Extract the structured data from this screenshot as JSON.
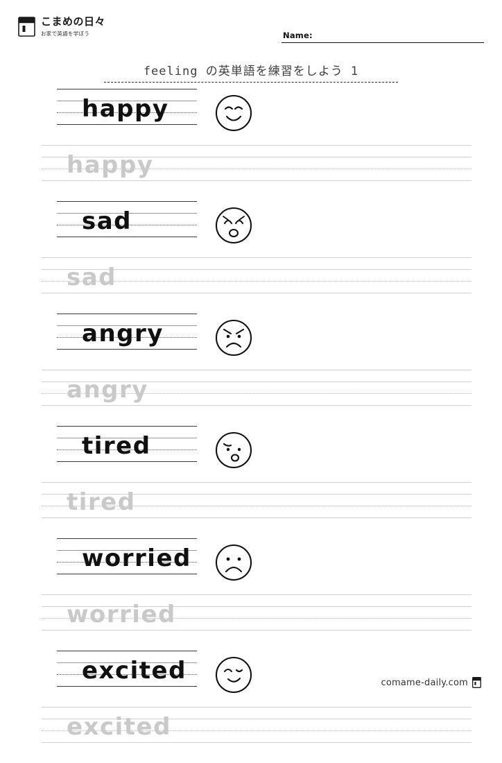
{
  "header": {
    "brand_title": "こまめの日々",
    "brand_subtitle": "お家で英語を学ぼう",
    "brand_icon": "notebook-icon",
    "name_label": "Name:"
  },
  "worksheet": {
    "title": "feeling の英単語を練習をしよう 1",
    "rows": [
      {
        "word": "happy",
        "trace": "happy",
        "face": "smiling-face"
      },
      {
        "word": "sad",
        "trace": "sad",
        "face": "crying-face"
      },
      {
        "word": "angry",
        "trace": "angry",
        "face": "angry-face"
      },
      {
        "word": "tired",
        "trace": "tired",
        "face": "tired-face"
      },
      {
        "word": "worried",
        "trace": "worried",
        "face": "worried-face"
      },
      {
        "word": "excited",
        "trace": "excited",
        "face": "excited-face"
      }
    ]
  },
  "footer": {
    "site": "comame-daily.com",
    "icon": "book-icon"
  }
}
